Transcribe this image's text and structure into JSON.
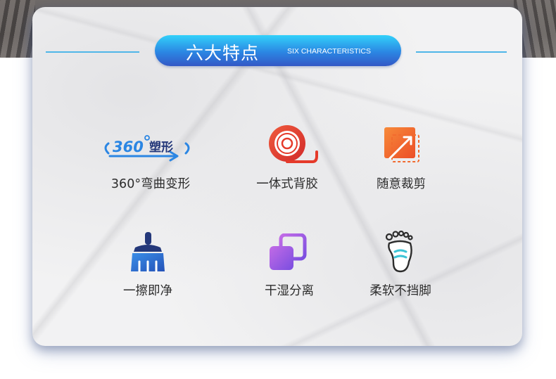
{
  "header": {
    "title_cn": "六大特点",
    "title_en": "SIX CHARACTERISTICS"
  },
  "features": [
    {
      "icon": "360-shaping-icon",
      "icon_text": "360",
      "icon_text_cn": "塑形",
      "label": "360°弯曲变形"
    },
    {
      "icon": "tape-roll-icon",
      "label": "一体式背胶"
    },
    {
      "icon": "crop-icon",
      "label": "随意裁剪"
    },
    {
      "icon": "brush-icon",
      "label": "一擦即净"
    },
    {
      "icon": "layers-icon",
      "label": "干湿分离"
    },
    {
      "icon": "foot-icon",
      "label": "柔软不挡脚"
    }
  ],
  "colors": {
    "accent_blue": "#2b86e3",
    "line_blue": "#4fb6e8",
    "red": "#e53a2a",
    "orange": "#f26b2e",
    "purple": "#8e55e0",
    "navy": "#24387a"
  }
}
